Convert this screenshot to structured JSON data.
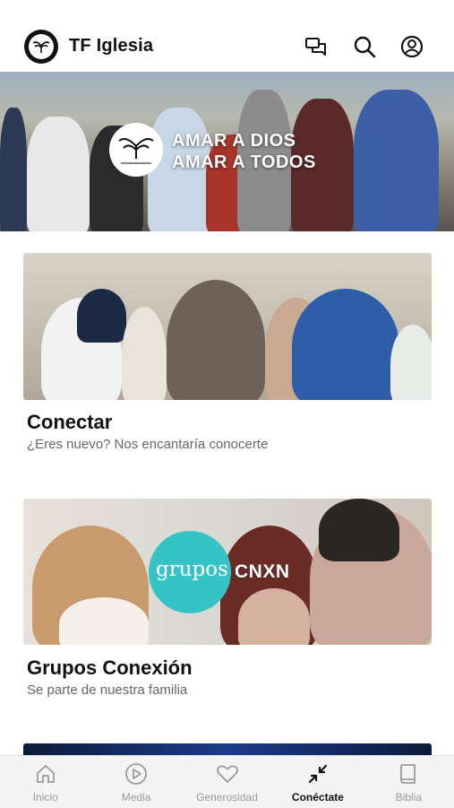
{
  "header": {
    "title": "TF Iglesia",
    "icons": [
      "logo-icon",
      "chat-icon",
      "search-icon",
      "profile-icon"
    ]
  },
  "hero": {
    "line1": "AMAR A DIOS",
    "line2": "AMAR A TODOS",
    "badge_text": "TIERRA FERTIL"
  },
  "cards": [
    {
      "title": "Conectar",
      "subtitle": "¿Eres nuevo? Nos encantaría conocerte"
    },
    {
      "title": "Grupos Conexión",
      "subtitle": "Se parte de nuestra familia",
      "image_text_left": "grupos",
      "image_text_right": "CNXN"
    }
  ],
  "tabs": [
    {
      "label": "Inicio",
      "icon": "home-icon",
      "active": false
    },
    {
      "label": "Media",
      "icon": "play-icon",
      "active": false
    },
    {
      "label": "Generosidad",
      "icon": "heart-icon",
      "active": false
    },
    {
      "label": "Conéctate",
      "icon": "connect-icon",
      "active": true
    },
    {
      "label": "Biblia",
      "icon": "book-icon",
      "active": false
    }
  ],
  "colors": {
    "accent_teal": "#36c3c6",
    "tab_inactive": "#9a9a9a",
    "tab_active": "#111111"
  }
}
